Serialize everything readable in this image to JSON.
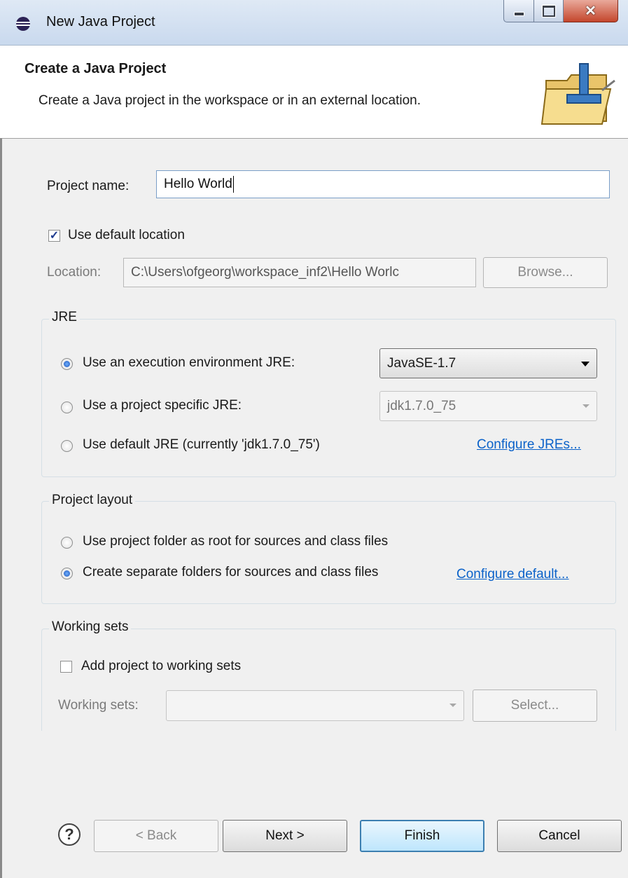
{
  "window": {
    "title": "New Java Project"
  },
  "banner": {
    "title": "Create a Java Project",
    "description": "Create a Java project in the workspace or in an external location."
  },
  "project": {
    "name_label": "Project name:",
    "name_value": "Hello World",
    "use_default_location_label": "Use default location",
    "use_default_location_checked": true,
    "location_label": "Location:",
    "location_value": "C:\\Users\\ofgeorg\\workspace_inf2\\Hello Worlc",
    "browse_label": "Browse..."
  },
  "jre": {
    "group_title": "JRE",
    "option_execution_env": "Use an execution environment JRE:",
    "execution_env_value": "JavaSE-1.7",
    "option_project_specific": "Use a project specific JRE:",
    "project_specific_value": "jdk1.7.0_75",
    "option_default": "Use default JRE (currently 'jdk1.7.0_75')",
    "configure_link": "Configure JREs...",
    "selected": "execution_env"
  },
  "layout": {
    "group_title": "Project layout",
    "option_root": "Use project folder as root for sources and class files",
    "option_separate": "Create separate folders for sources and class files",
    "configure_link": "Configure default...",
    "selected": "separate"
  },
  "working_sets": {
    "group_title": "Working sets",
    "add_label": "Add project to working sets",
    "add_checked": false,
    "sets_label": "Working sets:",
    "sets_value": "",
    "select_label": "Select..."
  },
  "footer": {
    "help_glyph": "?",
    "back_label": "< Back",
    "next_label": "Next >",
    "finish_label": "Finish",
    "cancel_label": "Cancel"
  },
  "icons": {
    "app": "eclipse-icon",
    "banner": "java-folder-icon",
    "help": "help-icon"
  },
  "colors": {
    "link": "#0b62c9",
    "default_button_border": "#3c7fb1",
    "close_button": "#c4462c"
  }
}
